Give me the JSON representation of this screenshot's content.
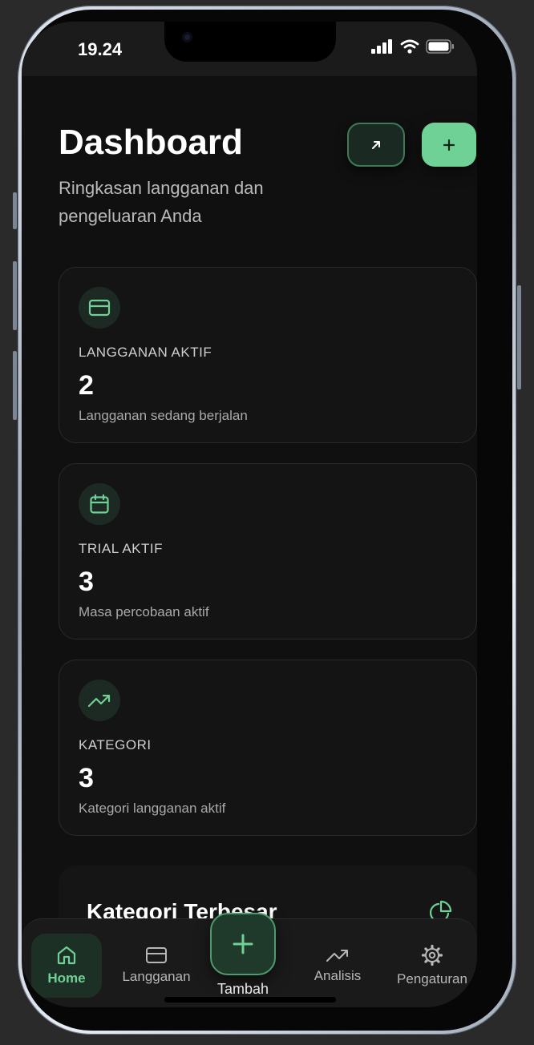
{
  "status_bar": {
    "time": "19.24",
    "icons": [
      "signal-icon",
      "wifi-icon",
      "battery-icon"
    ]
  },
  "header": {
    "title": "Dashboard",
    "subtitle": "Ringkasan langganan dan pengeluaran Anda",
    "buttons": [
      {
        "name": "export",
        "icon": "arrow-up-right-icon"
      },
      {
        "name": "add",
        "icon": "plus-icon"
      }
    ]
  },
  "stats": [
    {
      "icon": "credit-card-icon",
      "label": "LANGGANAN AKTIF",
      "value": "2",
      "description": "Langganan sedang berjalan"
    },
    {
      "icon": "calendar-icon",
      "label": "TRIAL AKTIF",
      "value": "3",
      "description": "Masa percobaan aktif"
    },
    {
      "icon": "trending-up-icon",
      "label": "KATEGORI",
      "value": "3",
      "description": "Kategori langganan aktif"
    }
  ],
  "section": {
    "title": "Kategori Terbesar",
    "icon": "pie-chart-icon"
  },
  "bottom_nav": {
    "items": [
      {
        "label": "Home",
        "icon": "home-icon",
        "active": true
      },
      {
        "label": "Langganan",
        "icon": "credit-card-icon"
      },
      {
        "label": "Tambah",
        "icon": "plus-icon"
      },
      {
        "label": "Analisis",
        "icon": "trending-up-icon"
      },
      {
        "label": "Pengaturan",
        "icon": "gear-icon"
      }
    ]
  },
  "colors": {
    "accent": "#6fd195",
    "background": "#101010",
    "card": "#141414"
  }
}
